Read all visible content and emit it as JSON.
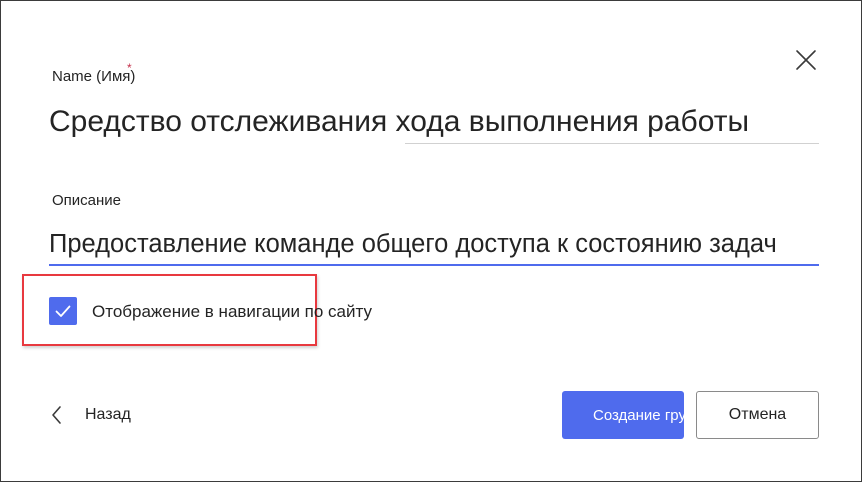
{
  "dialog": {
    "close_icon": "close-icon",
    "name_field": {
      "label": "Name (Имя)",
      "required_marker": "*",
      "value": "Средство отслеживания хода выполнения работы"
    },
    "description_field": {
      "label": "Описание",
      "value": "Предоставление команде общего доступа к состоянию задач"
    },
    "show_in_nav": {
      "label": "Отображение в навигации по сайту",
      "checked": true
    },
    "back": {
      "icon": "chevron-left-icon",
      "label": "Назад"
    },
    "create_button": "Создание группы",
    "cancel_button": "Отмена"
  },
  "colors": {
    "accent": "#4f6bed",
    "highlight_border": "#e8393f",
    "required": "#c4314b",
    "text": "#242424"
  }
}
